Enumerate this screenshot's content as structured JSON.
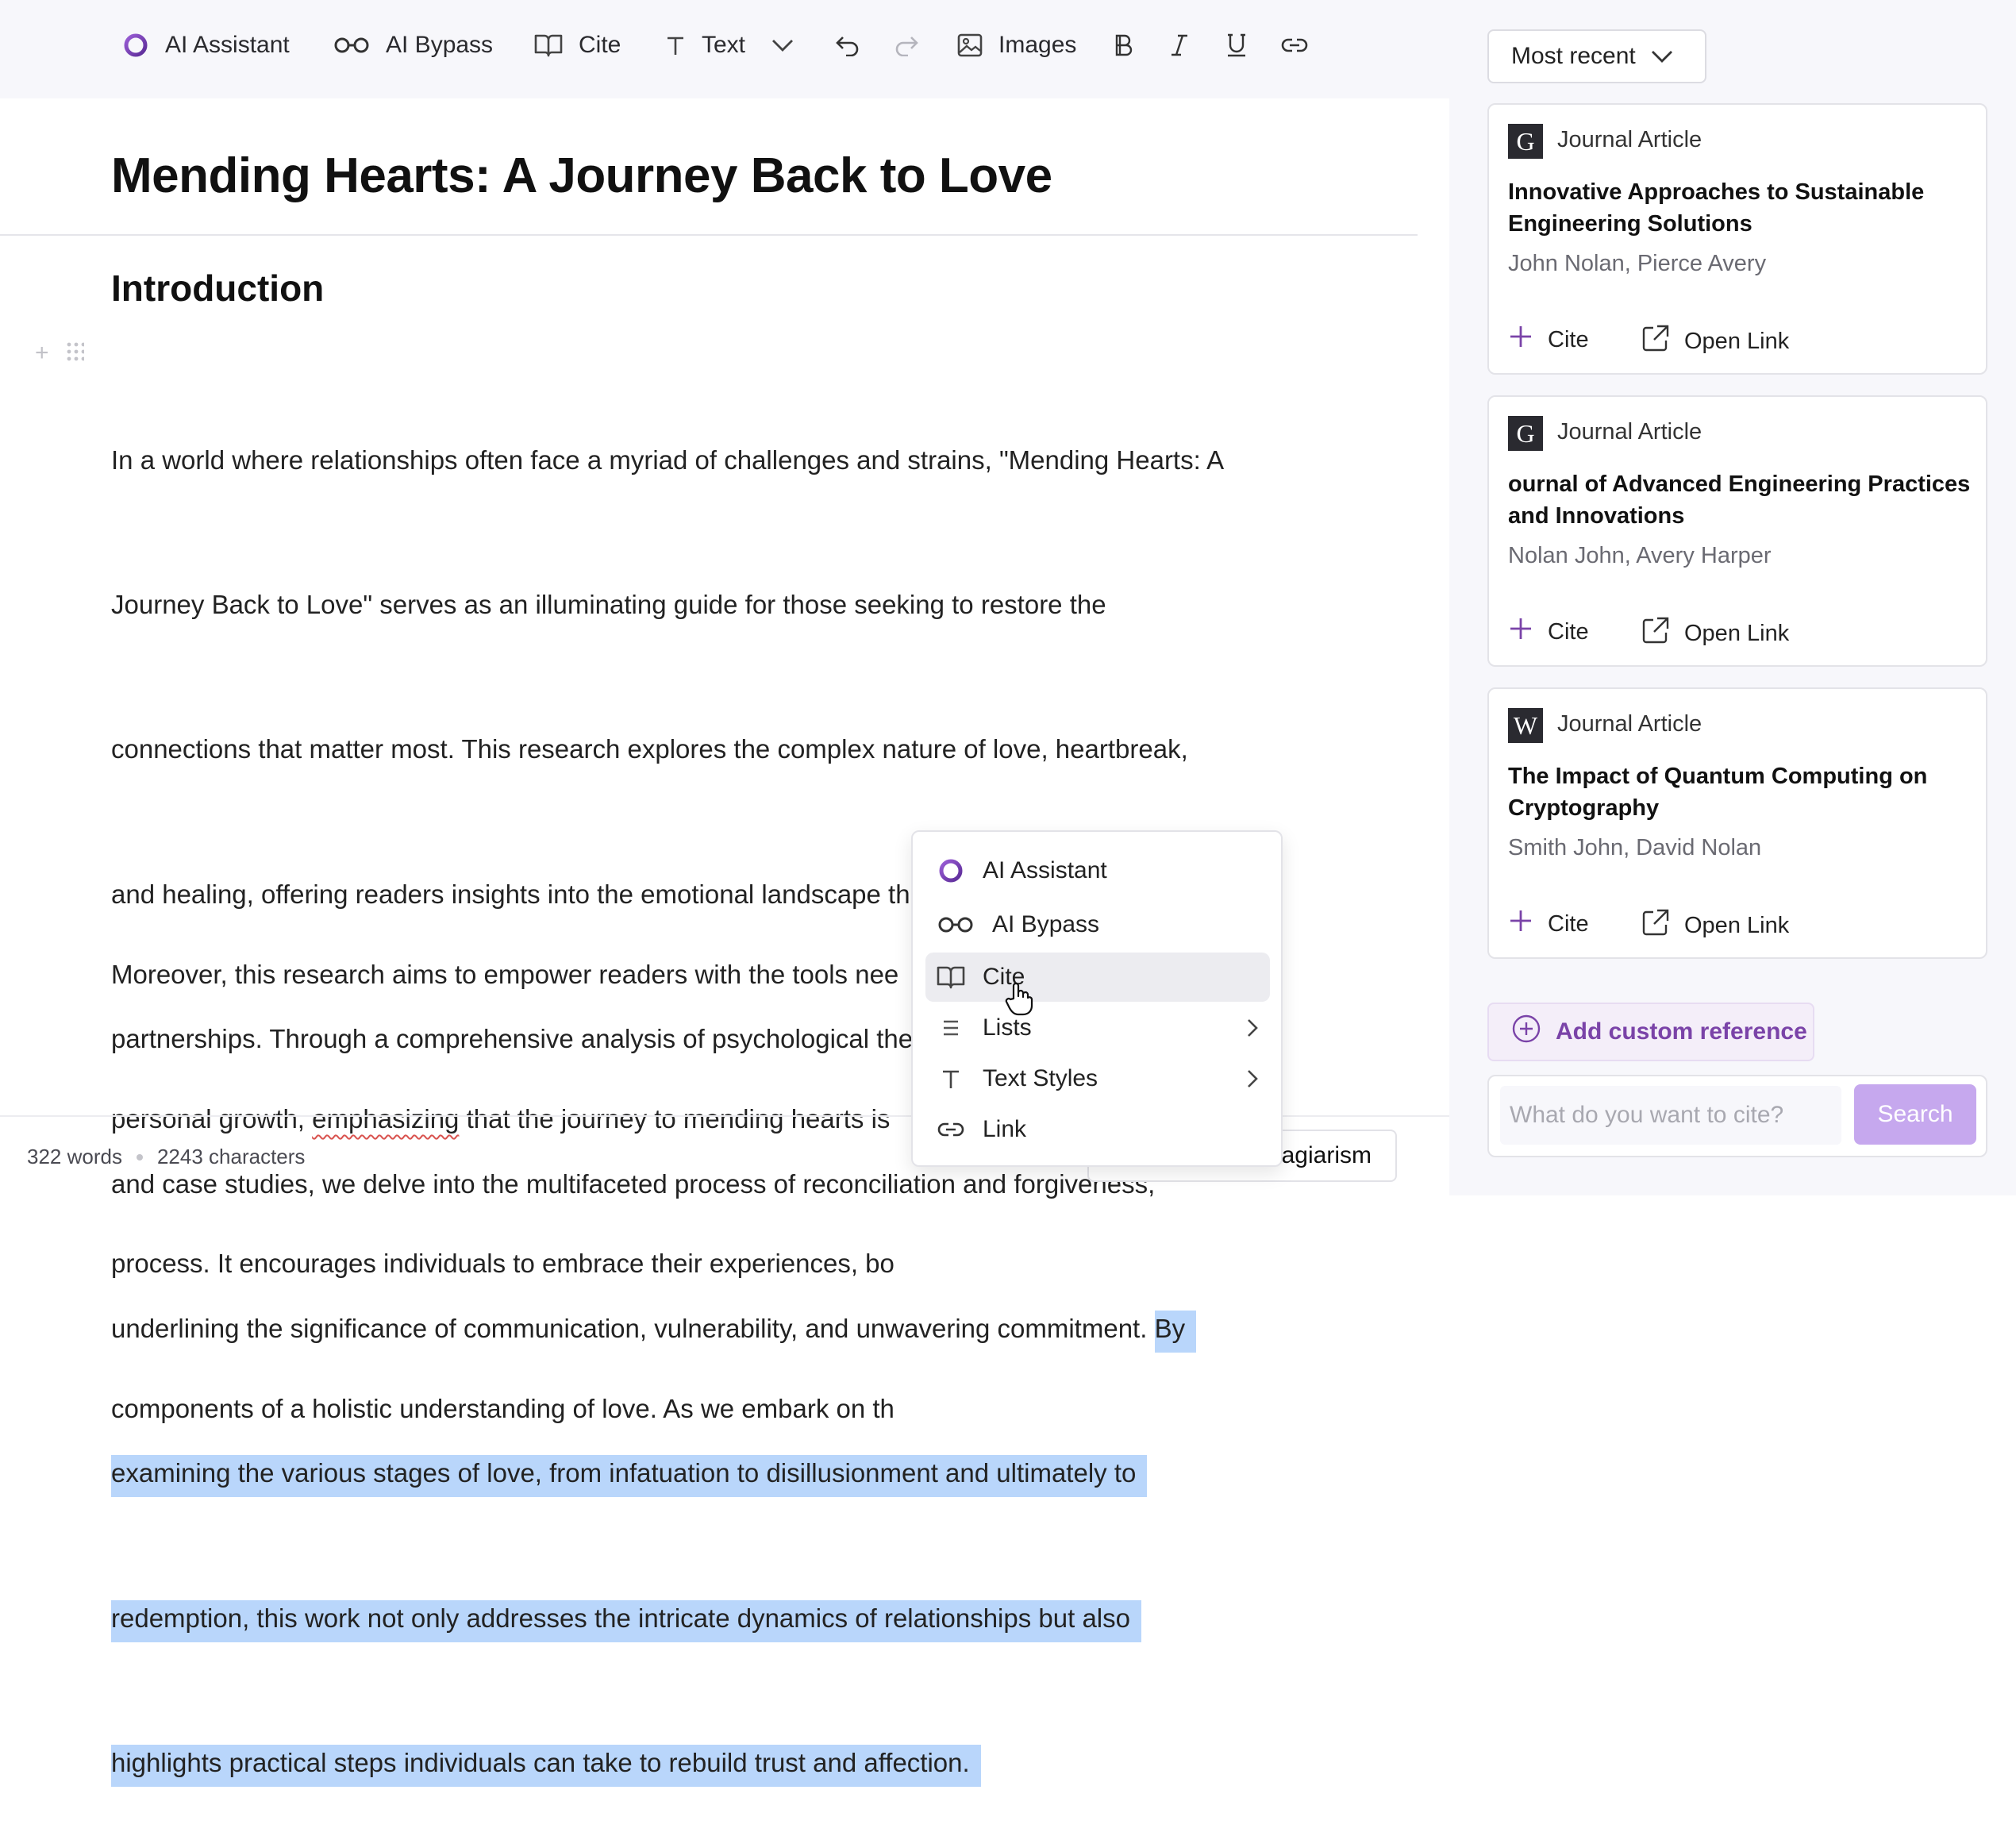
{
  "toolbar": {
    "ai_assistant": "AI Assistant",
    "ai_bypass": "AI Bypass",
    "cite": "Cite",
    "text": "Text",
    "images": "Images",
    "accent": "#7b3fb0"
  },
  "document": {
    "title": "Mending Hearts: A Journey Back to Love",
    "section_heading": "Introduction",
    "para1_lines": [
      "In a world where relationships often face a myriad of challenges and strains, \"Mending Hearts: A",
      "Journey Back to Love\" serves as an illuminating guide for those seeking to restore the",
      "connections that matter most. This research explores the complex nature of love, heartbreak,",
      "and healing, offering readers insights into the emotional landscape that defines romantic",
      "partnerships. Through a comprehensive analysis of psychological theories, personal narratives,",
      "and case studies, we delve into the multifaceted process of reconciliation and forgiveness,",
      "underlining the significance of communication, vulnerability, and unwavering commitment."
    ],
    "para1_selected": [
      "By",
      "examining the various stages of love, from infatuation to disillusionment and ultimately to",
      "redemption, this work not only addresses the intricate dynamics of relationships but also",
      "highlights practical steps individuals can take to rebuild trust and affection."
    ],
    "para2": {
      "line1": "Moreover, this research aims to empower readers with the tools nee",
      "line2_a": "personal growth, ",
      "line2_misspelled": "emphasizing",
      "line2_b": " that the journey to mending hearts is",
      "line3": "process. It encourages individuals to embrace their experiences, bo",
      "line4": "components of a holistic understanding of love. As we embark on th"
    },
    "highlight_color": "#b9d6fb"
  },
  "footer": {
    "words": "322 words",
    "characters": "2243 characters",
    "plagiarism_partial": "agiarism"
  },
  "context_menu": {
    "items": [
      {
        "label": "AI Assistant",
        "icon": "ai-assistant-ring-icon"
      },
      {
        "label": "AI Bypass",
        "icon": "glasses-icon"
      },
      {
        "label": "Cite",
        "icon": "book-icon"
      },
      {
        "label": "Lists",
        "icon": "list-icon"
      },
      {
        "label": "Text Styles",
        "icon": "text-t-icon"
      },
      {
        "label": "Link",
        "icon": "link-icon"
      }
    ]
  },
  "panel": {
    "sort_label": "Most recent",
    "cards": [
      {
        "source": "G",
        "type": "Journal Article",
        "title": "Innovative Approaches to Sustainable Engineering Solutions",
        "authors": "John Nolan, Pierce Avery",
        "cite": "Cite",
        "open": "Open Link"
      },
      {
        "source": "G",
        "type": "Journal Article",
        "title": "ournal of Advanced Engineering Practices and Innovations",
        "authors": "Nolan John, Avery Harper",
        "cite": "Cite",
        "open": "Open Link"
      },
      {
        "source": "W",
        "type": "Journal Article",
        "title": "The Impact of Quantum Computing on Cryptography",
        "authors": "Smith John, David Nolan",
        "cite": "Cite",
        "open": "Open Link"
      }
    ],
    "add_custom_reference": "Add custom reference",
    "search_placeholder": "What do you want to cite?",
    "search_button": "Search",
    "accent": "#7a43a8"
  }
}
